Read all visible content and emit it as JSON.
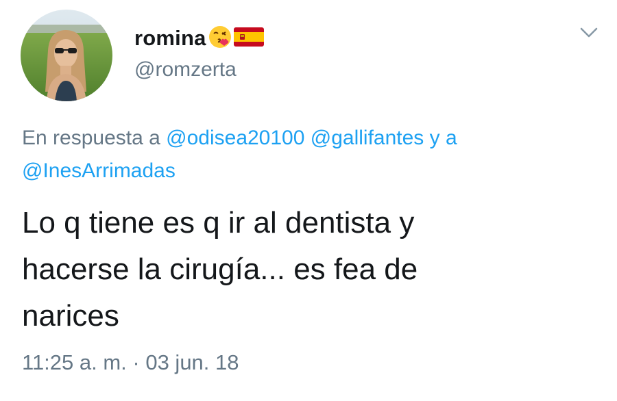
{
  "author": {
    "display_name": "romina",
    "emojis": [
      "kissing-face-emoji",
      "spain-flag-emoji"
    ],
    "handle": "@romzerta"
  },
  "reply_context": {
    "prefix": "En respuesta a",
    "mention_1": "@odisea20100",
    "mention_2": "@gallifantes",
    "conjunction": "y a",
    "mention_3": "@InesArrimadas"
  },
  "tweet": {
    "line_1": "Lo q tiene es q ir al dentista y",
    "line_2": "hacerse la cirugía... es fea de",
    "line_3": "narices",
    "timestamp": "11:25 a. m. · 03 jun. 18"
  },
  "colors": {
    "link": "#1da1f2",
    "secondary_text": "#657786",
    "primary_text": "#14171a"
  },
  "icons": {
    "menu": "chevron-down-icon"
  }
}
